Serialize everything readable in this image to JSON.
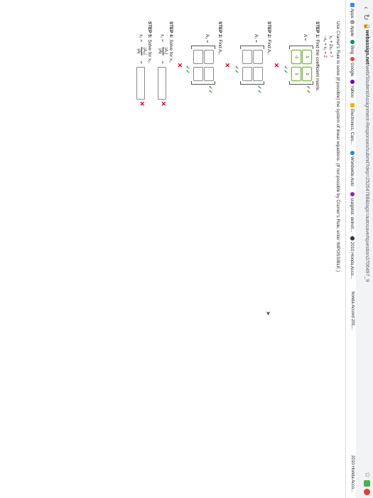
{
  "browser": {
    "url_domain": "webassign.net",
    "url_path": "/web/Student/Assignment-Responses/submit?dep=25264788&tags=autosave#question3706497_9",
    "bookmarks": [
      "Apps",
      "Apple",
      "Bing",
      "Google",
      "Yahoo",
      "Electronics, Cars...",
      "Worldwide Auto",
      "craigslist: detroit...",
      "2010 Honda Acco...",
      "honda Accord 201...",
      "2010 Honda Acco..."
    ]
  },
  "problem": {
    "instruction": "Use Cramer's Rule to solve (if possible) the system of linear equations. (If not possible by Cramer's Rule, enter IMPOSSIBLE.)",
    "eq1_lhs": "x₁ + 2x₂ =",
    "eq1_rhs": "7",
    "eq2_lhs": "−x₁ + x₂ =",
    "eq2_rhs": "2"
  },
  "step1": {
    "title": "STEP 1:",
    "text": "Find the coefficient matrix.",
    "label": "A =",
    "cells": [
      "1",
      "2",
      "-1",
      "1"
    ]
  },
  "step2": {
    "title": "STEP 2:",
    "text": "Find A₁.",
    "label": "A₁ =",
    "cells": [
      "",
      "",
      "",
      ""
    ]
  },
  "step3": {
    "title": "STEP 3:",
    "text": "Find A₂.",
    "label": "A₂ =",
    "cells": [
      "",
      "",
      "",
      ""
    ]
  },
  "step4": {
    "title": "STEP 4:",
    "text": "Solve for x₁.",
    "label": "x₁ =",
    "num": "|A₁|",
    "den": "|A|",
    "equals": "="
  },
  "step5": {
    "title": "STEP 5:",
    "text": "Solve for x₂.",
    "label": "x₂ =",
    "num": "|A₂|",
    "den": "|A|",
    "equals": "="
  },
  "symbols": {
    "check": "✓✓",
    "cross": "✕",
    "arrow": "→"
  },
  "colors": {
    "error": "#d0021b",
    "correct": "#7cb342"
  }
}
